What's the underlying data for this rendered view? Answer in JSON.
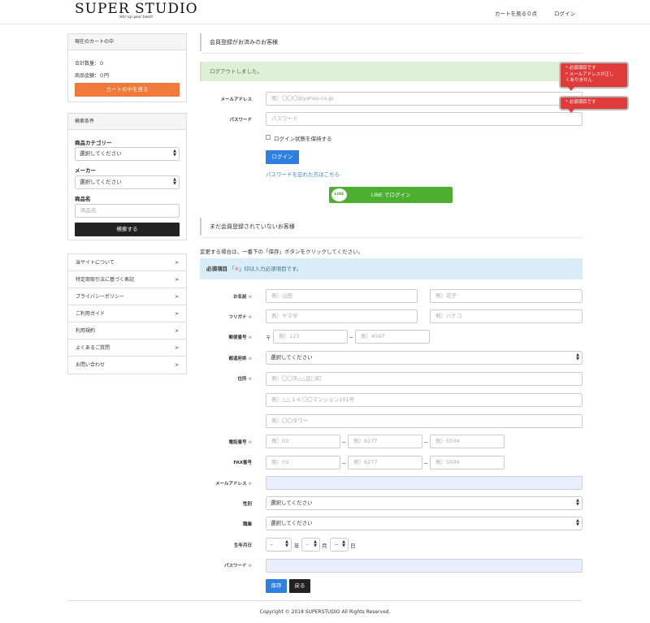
{
  "header": {
    "logo": "SUPER STUDIO",
    "tagline": "Stir up your heart",
    "cart_link": "カートを見る０点",
    "login_link": "ログイン"
  },
  "sidebar": {
    "cart": {
      "title": "現在のカートの中",
      "total_qty": "合計数量：０",
      "total_price": "商品金額：０円",
      "view_button": "カートの中を見る"
    },
    "search": {
      "title": "検索条件",
      "category_label": "商品カテゴリー",
      "category_value": "選択してください",
      "maker_label": "メーカー",
      "maker_value": "選択してください",
      "name_label": "商品名",
      "name_placeholder": "商品名",
      "search_button": "検索する"
    },
    "links": [
      {
        "label": "当サイトについて"
      },
      {
        "label": "特定商取引法に基づく表記"
      },
      {
        "label": "プライバシーポリシー"
      },
      {
        "label": "ご利用ガイド"
      },
      {
        "label": "利用規約"
      },
      {
        "label": "よくあるご質問"
      },
      {
        "label": "お問い合わせ"
      }
    ],
    "chevron": ">"
  },
  "login": {
    "section_title": "会員登録がお済みのお客様",
    "alert": "ログアウトしました。",
    "email_label": "メールアドレス",
    "email_placeholder": "例）〇〇〇@yahoo.co.jp",
    "password_label": "パスワード",
    "password_placeholder": "パスワード",
    "remember_label": "ログイン状態を保持する",
    "login_button": "ログイン",
    "forgot_link": "パスワードを忘れた方はこちら",
    "line_button": "LINE でログイン",
    "line_badge": "LINE",
    "tooltip_email": [
      "* 必須項目です",
      "* メールアドレスが正し",
      "くありません"
    ],
    "tooltip_password": [
      "* 必須項目です"
    ]
  },
  "register": {
    "section_title": "まだ会員登録されていないお客様",
    "note": "変更する場合は、一番下の「保存」ボタンをクリックしてください。",
    "required_bold": "必須項目",
    "required_open": "「",
    "required_mark": "※",
    "required_close": "」印は入力必須項目です。",
    "fields": {
      "name_label": "お名前",
      "name_last": "例）山田",
      "name_first": "例）花子",
      "kana_label": "フリガナ",
      "kana_last": "例）ヤマダ",
      "kana_first": "例）ハナコ",
      "zip_label": "郵便番号",
      "zip_mark": "〒",
      "zip1": "例）123",
      "zip2": "例）4567",
      "pref_label": "都道府県",
      "pref_value": "選択してください",
      "addr_label": "住所",
      "addr1": "例）〇〇市△△区□町",
      "addr2": "例）△△ 1-4 〇〇マンション101号",
      "addr3": "例）〇〇タワー",
      "tel_label": "電話番号",
      "tel1": "例）03",
      "tel2": "例）6277",
      "tel3": "例）5504",
      "fax_label": "FAX番号",
      "fax1": "例）03",
      "fax2": "例）6277",
      "fax3": "例）5504",
      "email_label": "メールアドレス",
      "gender_label": "性別",
      "gender_value": "選択してください",
      "job_label": "職業",
      "job_value": "選択してください",
      "birth_label": "生年月日",
      "birth_year": "-",
      "birth_year_unit": "年",
      "birth_month": "-",
      "birth_month_unit": "月",
      "birth_day": "--",
      "birth_day_unit": "日",
      "password_label": "パスワード"
    },
    "mark": "※",
    "dash": "－",
    "save_button": "保存",
    "back_button": "戻る"
  },
  "footer": {
    "copyright": "Copyright © 2018 SUPERSTUDIO All Rights Reserved."
  }
}
